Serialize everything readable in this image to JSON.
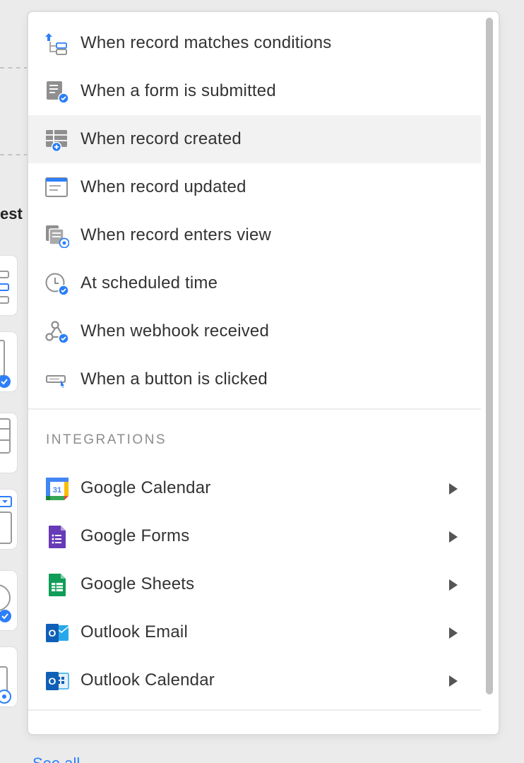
{
  "background": {
    "heading_fragment": "est",
    "link_label": "See all"
  },
  "menu": {
    "items": [
      {
        "label": "When record matches conditions",
        "icon": "conditions-icon"
      },
      {
        "label": "When a form is submitted",
        "icon": "form-submitted-icon"
      },
      {
        "label": "When record created",
        "icon": "record-created-icon",
        "highlighted": true
      },
      {
        "label": "When record updated",
        "icon": "record-updated-icon"
      },
      {
        "label": "When record enters view",
        "icon": "record-enters-view-icon"
      },
      {
        "label": "At scheduled time",
        "icon": "clock-icon"
      },
      {
        "label": "When webhook received",
        "icon": "webhook-icon"
      },
      {
        "label": "When a button is clicked",
        "icon": "button-clicked-icon"
      }
    ],
    "integrations_header": "INTEGRATIONS",
    "integrations": [
      {
        "label": "Google Calendar",
        "icon": "google-calendar-icon",
        "calendar_day": "31"
      },
      {
        "label": "Google Forms",
        "icon": "google-forms-icon"
      },
      {
        "label": "Google Sheets",
        "icon": "google-sheets-icon"
      },
      {
        "label": "Outlook Email",
        "icon": "outlook-email-icon",
        "letter": "O"
      },
      {
        "label": "Outlook Calendar",
        "icon": "outlook-calendar-icon",
        "letter": "O"
      }
    ]
  },
  "colors": {
    "accent_blue": "#2d7ff9",
    "highlight_row": "#f2f2f2",
    "text": "#333333",
    "section_header": "#8c8c8c"
  }
}
